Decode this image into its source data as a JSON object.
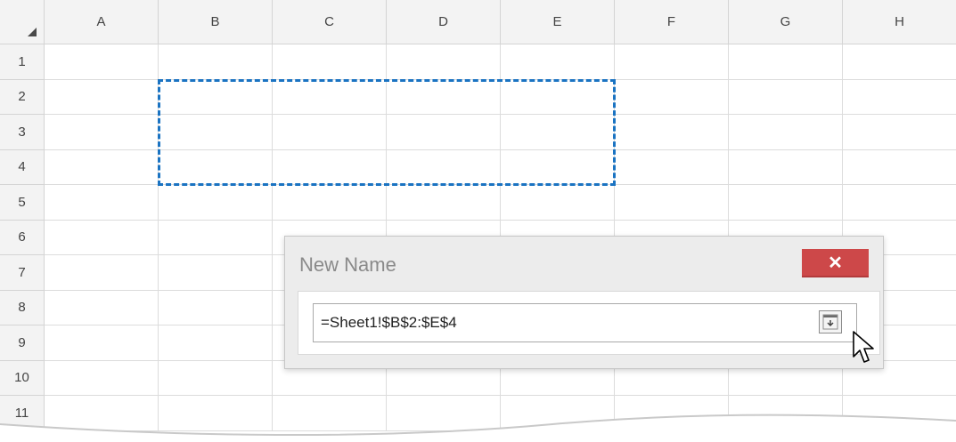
{
  "spreadsheet": {
    "corner_icon": "select-all-triangle-icon",
    "columns": [
      "A",
      "B",
      "C",
      "D",
      "E",
      "F",
      "G",
      "H"
    ],
    "rows": [
      "1",
      "2",
      "3",
      "4",
      "5",
      "6",
      "7",
      "8",
      "9",
      "10",
      "11"
    ],
    "selected_range": "B2:E4",
    "selection_color": "#1a73c2"
  },
  "dialog": {
    "title": "New Name",
    "close_label": "✕",
    "close_color": "#cd4849",
    "reference_value": "=Sheet1!$B$2:$E$4",
    "collapse_icon": "collapse-dialog-icon",
    "cursor_icon": "mouse-pointer-icon"
  }
}
